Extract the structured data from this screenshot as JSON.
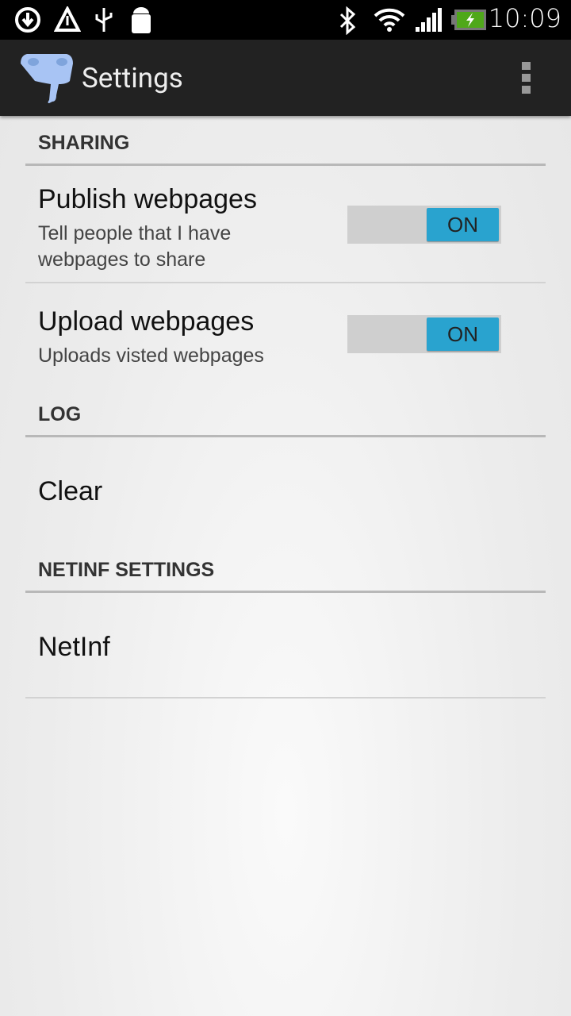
{
  "status_bar": {
    "time": "10:09",
    "icons": [
      "download-sync-icon",
      "warning-icon",
      "usb-icon",
      "android-debug-icon",
      "bluetooth-icon",
      "wifi-icon",
      "signal-icon",
      "battery-charging-icon"
    ]
  },
  "action_bar": {
    "title": "Settings",
    "logo": "elephant-logo",
    "overflow": "overflow-menu-icon"
  },
  "sections": [
    {
      "header": "SHARING",
      "items": [
        {
          "title": "Publish webpages",
          "summary": "Tell people that I have webpages to share",
          "toggle": "ON",
          "checked": true
        },
        {
          "title": "Upload webpages",
          "summary": "Uploads visted webpages",
          "toggle": "ON",
          "checked": true
        }
      ]
    },
    {
      "header": "LOG",
      "items": [
        {
          "title": "Clear"
        }
      ]
    },
    {
      "header": "NETINF SETTINGS",
      "items": [
        {
          "title": "NetInf"
        }
      ]
    }
  ],
  "colors": {
    "accent": "#29a3cf",
    "action_bar": "#222222"
  }
}
